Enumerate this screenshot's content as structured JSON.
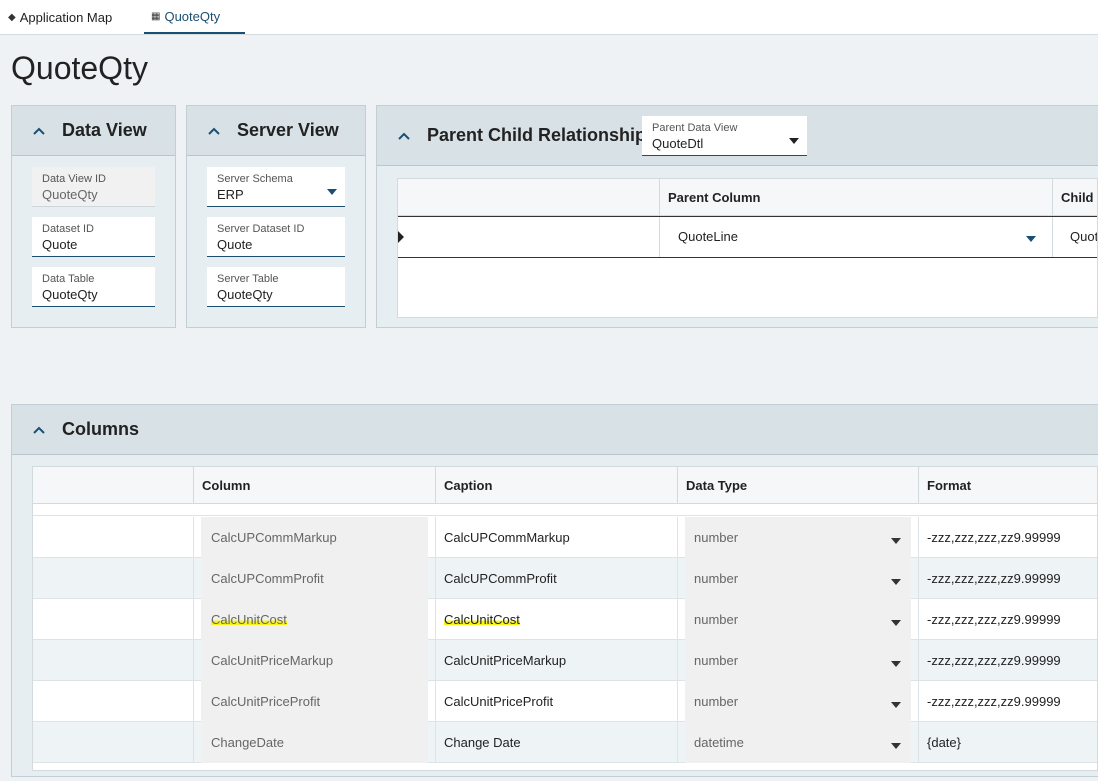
{
  "tabs": {
    "app_map": "Application Map",
    "active": "QuoteQty"
  },
  "page_title": "QuoteQty",
  "data_view": {
    "title": "Data View",
    "data_view_id": {
      "label": "Data View ID",
      "value": "QuoteQty"
    },
    "dataset_id": {
      "label": "Dataset ID",
      "value": "Quote"
    },
    "data_table": {
      "label": "Data Table",
      "value": "QuoteQty"
    }
  },
  "server_view": {
    "title": "Server View",
    "server_schema": {
      "label": "Server Schema",
      "value": "ERP"
    },
    "server_dataset_id": {
      "label": "Server Dataset ID",
      "value": "Quote"
    },
    "server_table": {
      "label": "Server Table",
      "value": "QuoteQty"
    }
  },
  "parent_child": {
    "title": "Parent Child Relationships",
    "parent_data_view": {
      "label": "Parent Data View",
      "value": "QuoteDtl"
    },
    "headers": [
      "Parent Column",
      "Child C"
    ],
    "row": {
      "parent_column": "QuoteLine",
      "child_column": "Quot"
    }
  },
  "columns": {
    "title": "Columns",
    "headers": [
      "Column",
      "Caption",
      "Data Type",
      "Format"
    ],
    "rows": [
      {
        "column": "CalcUPCommMarkup",
        "caption": "CalcUPCommMarkup",
        "data_type": "number",
        "format": "-zzz,zzz,zzz,zz9.99999"
      },
      {
        "column": "CalcUPCommProfit",
        "caption": "CalcUPCommProfit",
        "data_type": "number",
        "format": "-zzz,zzz,zzz,zz9.99999"
      },
      {
        "column": "CalcUnitCost",
        "caption": "CalcUnitCost",
        "data_type": "number",
        "format": "-zzz,zzz,zzz,zz9.99999",
        "highlighted": true
      },
      {
        "column": "CalcUnitPriceMarkup",
        "caption": "CalcUnitPriceMarkup",
        "data_type": "number",
        "format": "-zzz,zzz,zzz,zz9.99999"
      },
      {
        "column": "CalcUnitPriceProfit",
        "caption": "CalcUnitPriceProfit",
        "data_type": "number",
        "format": "-zzz,zzz,zzz,zz9.99999"
      },
      {
        "column": "ChangeDate",
        "caption": "Change Date",
        "data_type": "datetime",
        "format": "{date}"
      }
    ]
  },
  "colors": {
    "accent": "#1b4f72",
    "panel": "#d8e2e6",
    "highlight": "#f7f21a"
  }
}
